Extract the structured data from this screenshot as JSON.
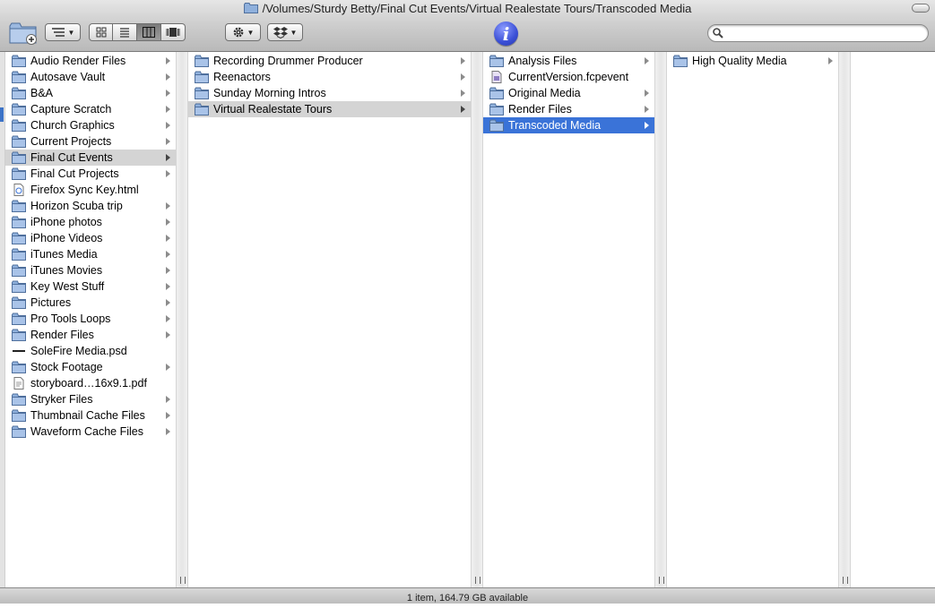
{
  "window": {
    "title": "/Volumes/Sturdy Betty/Final Cut Events/Virtual Realestate Tours/Transcoded Media"
  },
  "toolbar": {
    "new_folder_icon": "new-folder-icon",
    "arrange_icon": "arrange-icon",
    "view_modes": [
      "icon-view",
      "list-view",
      "column-view",
      "cover-flow-view"
    ],
    "active_view": "column-view",
    "action_icon": "gear-icon",
    "dropbox_icon": "dropbox-icon",
    "info_label": "i",
    "search": {
      "value": "",
      "placeholder": ""
    }
  },
  "colors": {
    "selection_blue": "#3a73d8",
    "selection_gray": "#d4d4d4",
    "folder_blue": "#8fb0dc",
    "info_blue": "#3a4fd6"
  },
  "columns": [
    {
      "items": [
        {
          "label": "Audio Render Files",
          "type": "folder",
          "arrow": true
        },
        {
          "label": "Autosave Vault",
          "type": "folder",
          "arrow": true
        },
        {
          "label": "B&A",
          "type": "folder",
          "arrow": true
        },
        {
          "label": "Capture Scratch",
          "type": "folder",
          "arrow": true
        },
        {
          "label": "Church Graphics",
          "type": "folder",
          "arrow": true
        },
        {
          "label": "Current Projects",
          "type": "folder",
          "arrow": true
        },
        {
          "label": "Final Cut Events",
          "type": "folder",
          "arrow": true,
          "selected": "gray"
        },
        {
          "label": "Final Cut Projects",
          "type": "folder",
          "arrow": true
        },
        {
          "label": "Firefox Sync Key.html",
          "type": "html-file",
          "arrow": false
        },
        {
          "label": "Horizon Scuba trip",
          "type": "folder",
          "arrow": true
        },
        {
          "label": "iPhone photos",
          "type": "folder",
          "arrow": true
        },
        {
          "label": "iPhone Videos",
          "type": "folder",
          "arrow": true
        },
        {
          "label": "iTunes Media",
          "type": "folder",
          "arrow": true
        },
        {
          "label": "iTunes Movies",
          "type": "folder",
          "arrow": true
        },
        {
          "label": "Key West Stuff",
          "type": "folder",
          "arrow": true
        },
        {
          "label": "Pictures",
          "type": "folder",
          "arrow": true
        },
        {
          "label": "Pro Tools Loops",
          "type": "folder",
          "arrow": true
        },
        {
          "label": "Render Files",
          "type": "folder",
          "arrow": true
        },
        {
          "label": "SoleFire Media.psd",
          "type": "psd-file",
          "arrow": false
        },
        {
          "label": "Stock Footage",
          "type": "folder",
          "arrow": true
        },
        {
          "label": "storyboard…16x9.1.pdf",
          "type": "pdf-file",
          "arrow": false
        },
        {
          "label": "Stryker Files",
          "type": "folder",
          "arrow": true
        },
        {
          "label": "Thumbnail Cache Files",
          "type": "folder",
          "arrow": true
        },
        {
          "label": "Waveform Cache Files",
          "type": "folder",
          "arrow": true
        }
      ]
    },
    {
      "items": [
        {
          "label": "Recording Drummer Producer",
          "type": "folder",
          "arrow": true
        },
        {
          "label": "Reenactors",
          "type": "folder",
          "arrow": true
        },
        {
          "label": "Sunday Morning Intros",
          "type": "folder",
          "arrow": true
        },
        {
          "label": "Virtual Realestate Tours",
          "type": "folder",
          "arrow": true,
          "selected": "gray"
        }
      ]
    },
    {
      "items": [
        {
          "label": "Analysis Files",
          "type": "folder",
          "arrow": true
        },
        {
          "label": "CurrentVersion.fcpevent",
          "type": "fcpevent-file",
          "arrow": false
        },
        {
          "label": "Original Media",
          "type": "folder",
          "arrow": true
        },
        {
          "label": "Render Files",
          "type": "folder",
          "arrow": true
        },
        {
          "label": "Transcoded Media",
          "type": "folder",
          "arrow": true,
          "selected": "blue"
        }
      ]
    },
    {
      "items": [
        {
          "label": "High Quality Media",
          "type": "folder",
          "arrow": true
        }
      ]
    }
  ],
  "status": {
    "text": "1 item, 164.79 GB available"
  }
}
